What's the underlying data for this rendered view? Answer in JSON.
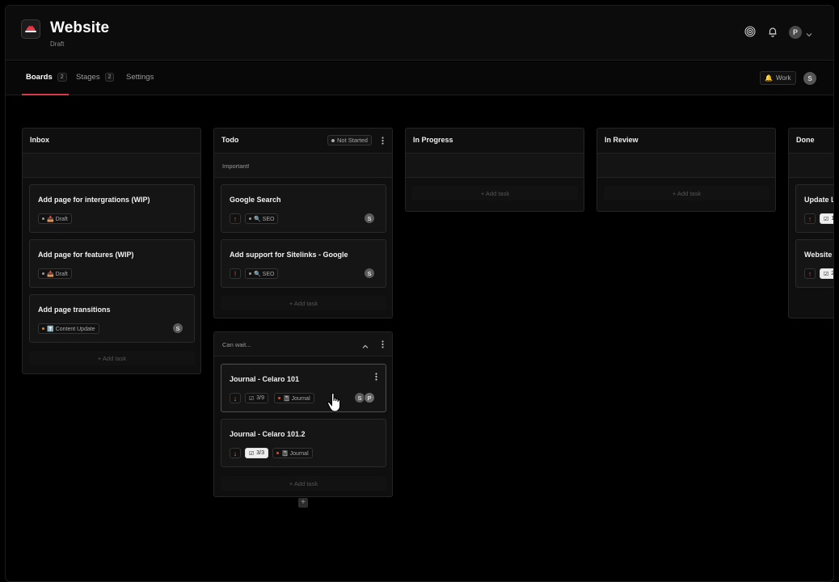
{
  "header": {
    "title": "Website",
    "subtitle": "Draft",
    "user_initial": "P",
    "icons": [
      "target-icon",
      "bell-icon",
      "chevron-down-icon"
    ]
  },
  "tabs": [
    {
      "label": "Boards",
      "count": "2",
      "active": true
    },
    {
      "label": "Stages",
      "count": "2",
      "active": false
    },
    {
      "label": "Settings",
      "count": "",
      "active": false
    }
  ],
  "toolbar": {
    "work_label": "Work",
    "user_initial": "S"
  },
  "board": {
    "add_task_label": "+ Add task",
    "columns": [
      {
        "title": "Inbox",
        "cards": [
          {
            "title": "Add page for intergrations (WIP)",
            "tag": "📥 Draft"
          },
          {
            "title": "Add page for features (WIP)",
            "tag": "📥 Draft"
          },
          {
            "title": "Add page transitions",
            "tag": "⬆️ Content Update",
            "assignee": "S"
          }
        ]
      },
      {
        "title": "Todo",
        "status": "Not Started",
        "group_label": "Important!",
        "cards": [
          {
            "title": "Google Search",
            "priority": "↑",
            "tag": "🔍 SEO",
            "assignee": "S"
          },
          {
            "title": "Add support for Sitelinks - Google",
            "priority": "!",
            "tag": "🔍 SEO",
            "assignee": "S"
          }
        ],
        "second_group": {
          "label": "Can wait...",
          "cards": [
            {
              "title": "Journal - Celaro 101",
              "priority": "↓",
              "checklist": "3/9",
              "tag": "📓 Journal",
              "assignees": [
                "S",
                "P"
              ]
            },
            {
              "title": "Journal - Celaro 101.2",
              "priority": "↓",
              "checklist": "3/3",
              "tag": "📓 Journal"
            }
          ]
        }
      },
      {
        "title": "In Progress",
        "cards": []
      },
      {
        "title": "In Review",
        "cards": []
      },
      {
        "title": "Done",
        "cards": [
          {
            "title": "Update L",
            "priority": "↑",
            "checklist": "1"
          },
          {
            "title": "Website ",
            "priority": "↑",
            "checklist": "2"
          }
        ]
      }
    ]
  },
  "colors": {
    "accent": "#d63a4a",
    "priority_high": "#d0503e",
    "priority_low": "#d08a2e",
    "background": "#000000",
    "card": "#151515"
  }
}
